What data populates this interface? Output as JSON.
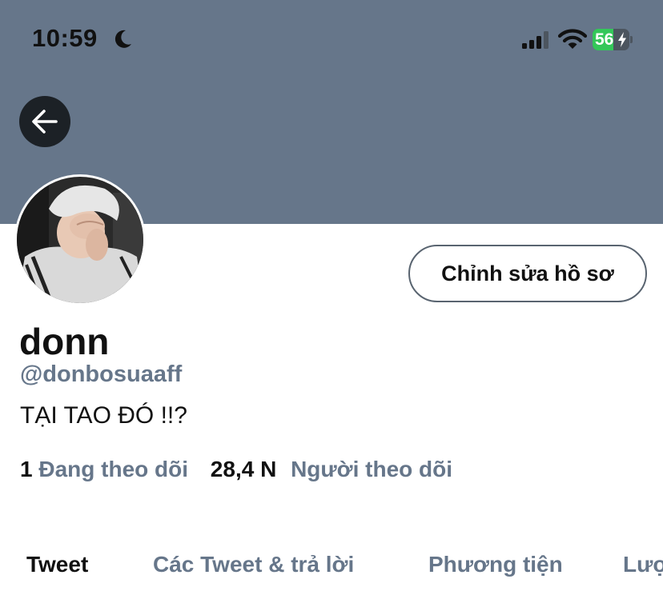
{
  "status_bar": {
    "time": "10:59",
    "battery_level": "56",
    "battery_fraction": 0.56,
    "icons": [
      "moon-icon",
      "cellular-signal-icon",
      "wifi-icon",
      "battery-charging-icon"
    ]
  },
  "colors": {
    "banner": "#66768a",
    "secondary_text": "#66768a",
    "primary_text": "#111111",
    "back_button_bg": "#1c2126",
    "battery_green": "#34c759"
  },
  "profile": {
    "display_name": "donn",
    "handle": "@donbosuaaff",
    "bio": "TẠI TAO ĐÓ !!?",
    "edit_button_label": "Chỉnh sửa hồ sơ",
    "following_count": "1",
    "following_label": "Đang theo dõi",
    "followers_count": "28,4 N",
    "followers_label": "Người theo dõi"
  },
  "tabs": [
    {
      "label": "Tweet",
      "active": true
    },
    {
      "label": "Các Tweet & trả lời",
      "active": false
    },
    {
      "label": "Phương tiện",
      "active": false
    },
    {
      "label": "Lượ",
      "active": false
    }
  ]
}
